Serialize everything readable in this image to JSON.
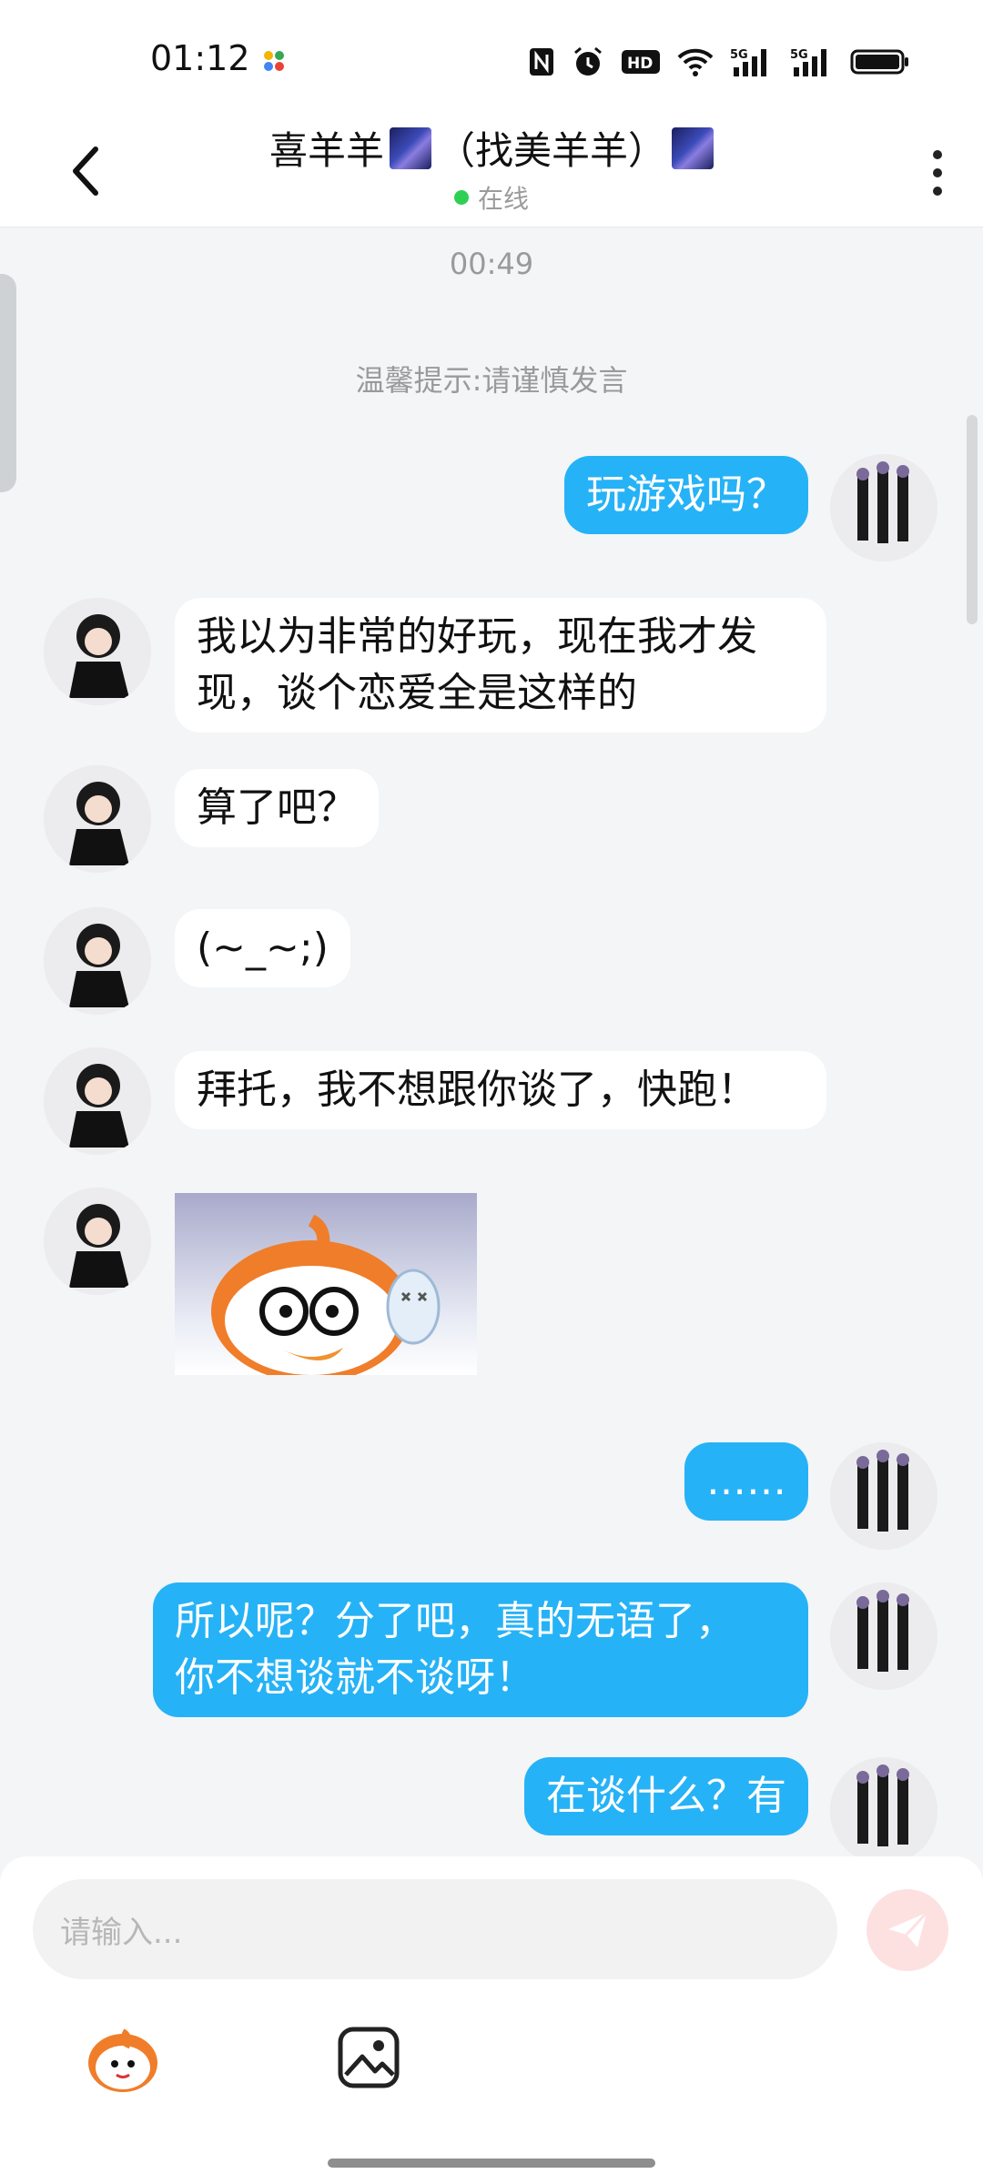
{
  "status_bar": {
    "time": "01:12",
    "icons": [
      "nfc-icon",
      "alarm-icon",
      "hd-icon",
      "wifi-icon",
      "5g-signal-icon",
      "5g-signal-icon",
      "battery-icon"
    ],
    "network_label_1": "5G",
    "network_label_2": "5G",
    "hd_label": "HD"
  },
  "header": {
    "title_name": "喜羊羊",
    "title_suffix": "（找美羊羊）",
    "status": "在线",
    "status_color": "#2fcf54"
  },
  "chat": {
    "timestamp": "00:49",
    "tip": "温馨提示:请谨慎发言",
    "messages": [
      {
        "dir": "out",
        "text": "玩游戏吗？"
      },
      {
        "dir": "in",
        "line1": "我以为非常的好玩，现在我才发",
        "line2": "现，谈个恋爱全是这样的"
      },
      {
        "dir": "in",
        "text": "算了吧？"
      },
      {
        "dir": "in",
        "text": "(~_~;)"
      },
      {
        "dir": "in",
        "text": "拜托，我不想跟你谈了，快跑！"
      },
      {
        "dir": "in",
        "type": "sticker",
        "sticker": "cartoon-sticker"
      },
      {
        "dir": "out",
        "text": "……"
      },
      {
        "dir": "out",
        "line1": "所以呢？分了吧，真的无语了，",
        "line2": "你不想谈就不谈呀！"
      },
      {
        "dir": "out",
        "text": "在谈什么？有"
      }
    ],
    "bubble_out_color": "#26b2f6",
    "bubble_in_color": "#ffffff"
  },
  "input": {
    "placeholder": "请输入..."
  },
  "toolbar": {
    "emoji_icon": "emoji-icon",
    "image_icon": "image-icon",
    "send_icon": "send-icon"
  }
}
